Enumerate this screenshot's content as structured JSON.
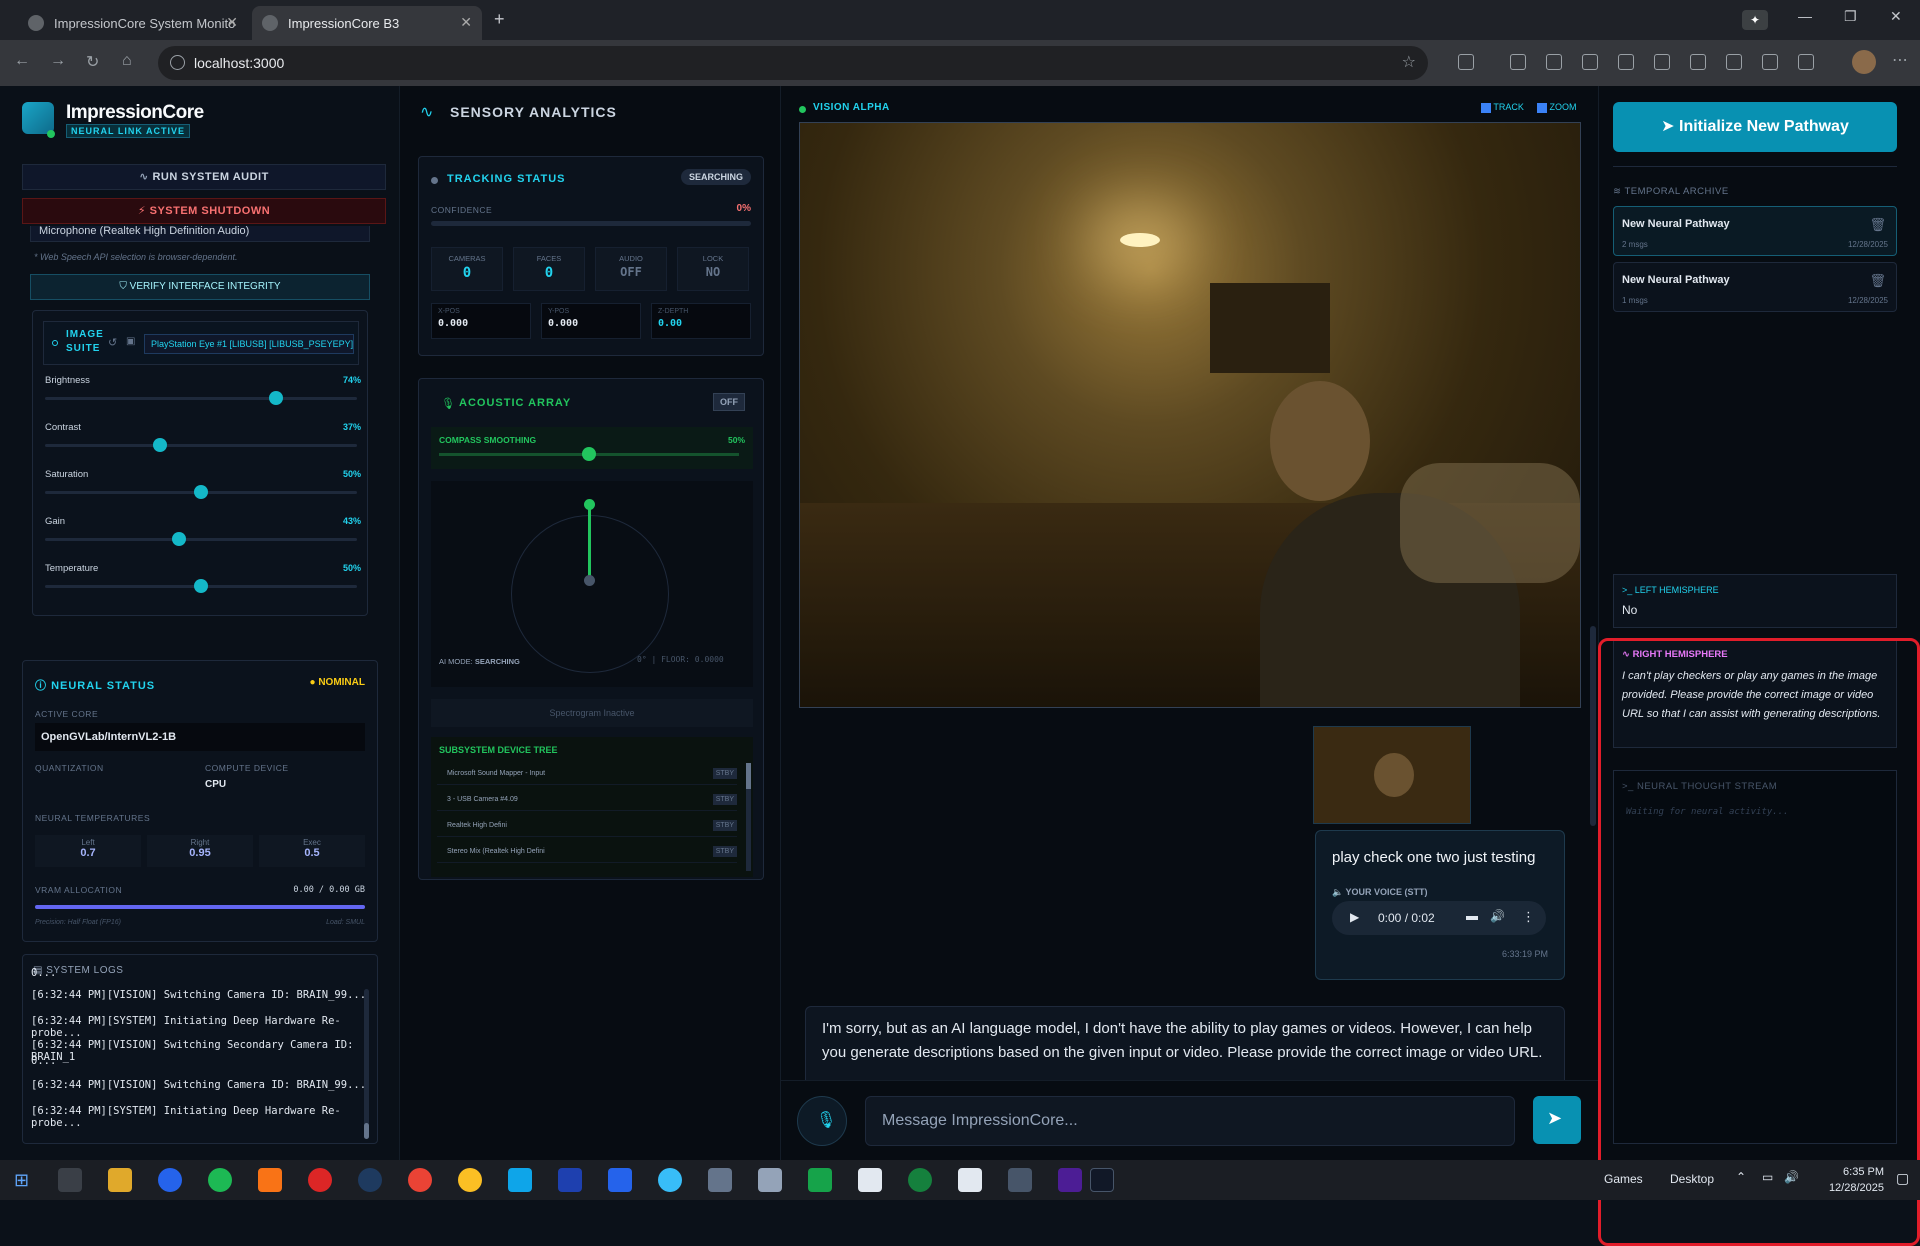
{
  "browser": {
    "tabs": [
      {
        "label": "ImpressionCore System Monito"
      },
      {
        "label": "ImpressionCore B3"
      }
    ],
    "url": "localhost:3000"
  },
  "left": {
    "brand": "ImpressionCore",
    "brand_sub": "NEURAL LINK ACTIVE",
    "run_audit": "RUN SYSTEM AUDIT",
    "shutdown": "SYSTEM SHUTDOWN",
    "mic_select": "Microphone (Realtek High Definition Audio)",
    "mic_note": "* Web Speech API selection is browser-dependent.",
    "verify": "VERIFY INTERFACE INTEGRITY",
    "image_suite": {
      "title_line1": "IMAGE",
      "title_line2": "SUITE",
      "camera": "PlayStation Eye #1 [LIBUSB] [LIBUSB_PSEYEPY]",
      "sliders": [
        {
          "label": "Brightness",
          "value": "74%",
          "fraction": 0.74
        },
        {
          "label": "Contrast",
          "value": "37%",
          "fraction": 0.37
        },
        {
          "label": "Saturation",
          "value": "50%",
          "fraction": 0.5
        },
        {
          "label": "Gain",
          "value": "43%",
          "fraction": 0.43
        },
        {
          "label": "Temperature",
          "value": "50%",
          "fraction": 0.5
        }
      ]
    },
    "neural": {
      "title": "NEURAL STATUS",
      "status": "NOMINAL",
      "active_core_label": "ACTIVE CORE",
      "active_core": "OpenGVLab/InternVL2-1B",
      "quant_label": "QUANTIZATION",
      "compute_label": "COMPUTE DEVICE",
      "compute": "CPU",
      "temps_label": "NEURAL TEMPERATURES",
      "temps": [
        {
          "label": "Left",
          "value": "0.7"
        },
        {
          "label": "Right",
          "value": "0.95"
        },
        {
          "label": "Exec",
          "value": "0.5"
        }
      ],
      "vram_label": "VRAM ALLOCATION",
      "vram_value": "0.00 / 0.00 GB",
      "precision": "Precision: Half Float (FP16)",
      "load": "Load: SMUL"
    },
    "logs": {
      "title": "SYSTEM LOGS",
      "lines": [
        "0...",
        "[6:32:44 PM][VISION] Switching Camera ID: BRAIN_99...",
        "[6:32:44 PM][SYSTEM] Initiating Deep Hardware Re-probe...",
        "[6:32:44 PM][VISION] Switching Secondary Camera ID: BRAIN_1",
        "0...",
        "[6:32:44 PM][VISION] Switching Camera ID: BRAIN_99...",
        "[6:32:44 PM][SYSTEM] Initiating Deep Hardware Re-probe..."
      ]
    }
  },
  "sensory": {
    "title": "SENSORY ANALYTICS",
    "tracking": {
      "title": "TRACKING STATUS",
      "badge": "SEARCHING",
      "confidence_label": "CONFIDENCE",
      "confidence": "0%",
      "stats": [
        {
          "label": "CAMERAS",
          "value": "0"
        },
        {
          "label": "FACES",
          "value": "0"
        },
        {
          "label": "AUDIO",
          "value": "OFF"
        },
        {
          "label": "LOCK",
          "value": "NO"
        }
      ],
      "positions": [
        {
          "label": "X-POS",
          "value": "0.000"
        },
        {
          "label": "Y-POS",
          "value": "0.000"
        },
        {
          "label": "Z-DEPTH",
          "value": "0.00"
        }
      ]
    },
    "acoustic": {
      "title": "ACOUSTIC ARRAY",
      "toggle": "OFF",
      "smoothing_label": "COMPASS SMOOTHING",
      "smoothing_value": "50%",
      "smoothing_fraction": 0.5,
      "ai_mode_label": "AI MODE:",
      "ai_mode": "SEARCHING",
      "angle": "0°",
      "floor": "FLOOR: 0.0000",
      "spectrogram": "Spectrogram Inactive",
      "device_tree_title": "SUBSYSTEM DEVICE TREE",
      "devices": [
        {
          "name": "Microsoft Sound Mapper - Input",
          "status": "STBY"
        },
        {
          "name": "3 - USB Camera #4.09",
          "status": "STBY"
        },
        {
          "name": "Realtek High Defini",
          "status": "STBY"
        },
        {
          "name": "Stereo Mix (Realtek High Defini",
          "status": "STBY"
        }
      ]
    }
  },
  "vision": {
    "title": "VISION ALPHA",
    "track_label": "TRACK",
    "zoom_label": "ZOOM",
    "user_msg": "play check one two just testing",
    "voice_label": "YOUR VOICE (STT)",
    "audio_time": "0:00 / 0:02",
    "user_time": "6:33:19 PM",
    "ai_msg": "I'm sorry, but as an AI language model, I don't have the ability to play games or videos. However, I can help you generate descriptions based on the given input or video. Please provide the correct image or video URL.",
    "input_placeholder": "Message ImpressionCore..."
  },
  "right": {
    "init_btn": "Initialize New Pathway",
    "archive_title": "TEMPORAL ARCHIVE",
    "archive": [
      {
        "title": "New Neural Pathway",
        "meta": "2 msgs",
        "date": "12/28/2025"
      },
      {
        "title": "New Neural Pathway",
        "meta": "1 msgs",
        "date": "12/28/2025"
      }
    ],
    "left_hemi_title": "LEFT HEMISPHERE",
    "left_hemi_text": "No",
    "right_hemi_title": "RIGHT HEMISPHERE",
    "right_hemi_text": "I can't play checkers or play any games in the image provided. Please provide the correct image or video URL so that I can assist with generating descriptions.",
    "thought_title": "NEURAL THOUGHT STREAM",
    "thought_placeholder": "Waiting for neural activity..."
  },
  "taskbar": {
    "games": "Games",
    "desktop": "Desktop",
    "time": "6:35 PM",
    "date": "12/28/2025"
  }
}
